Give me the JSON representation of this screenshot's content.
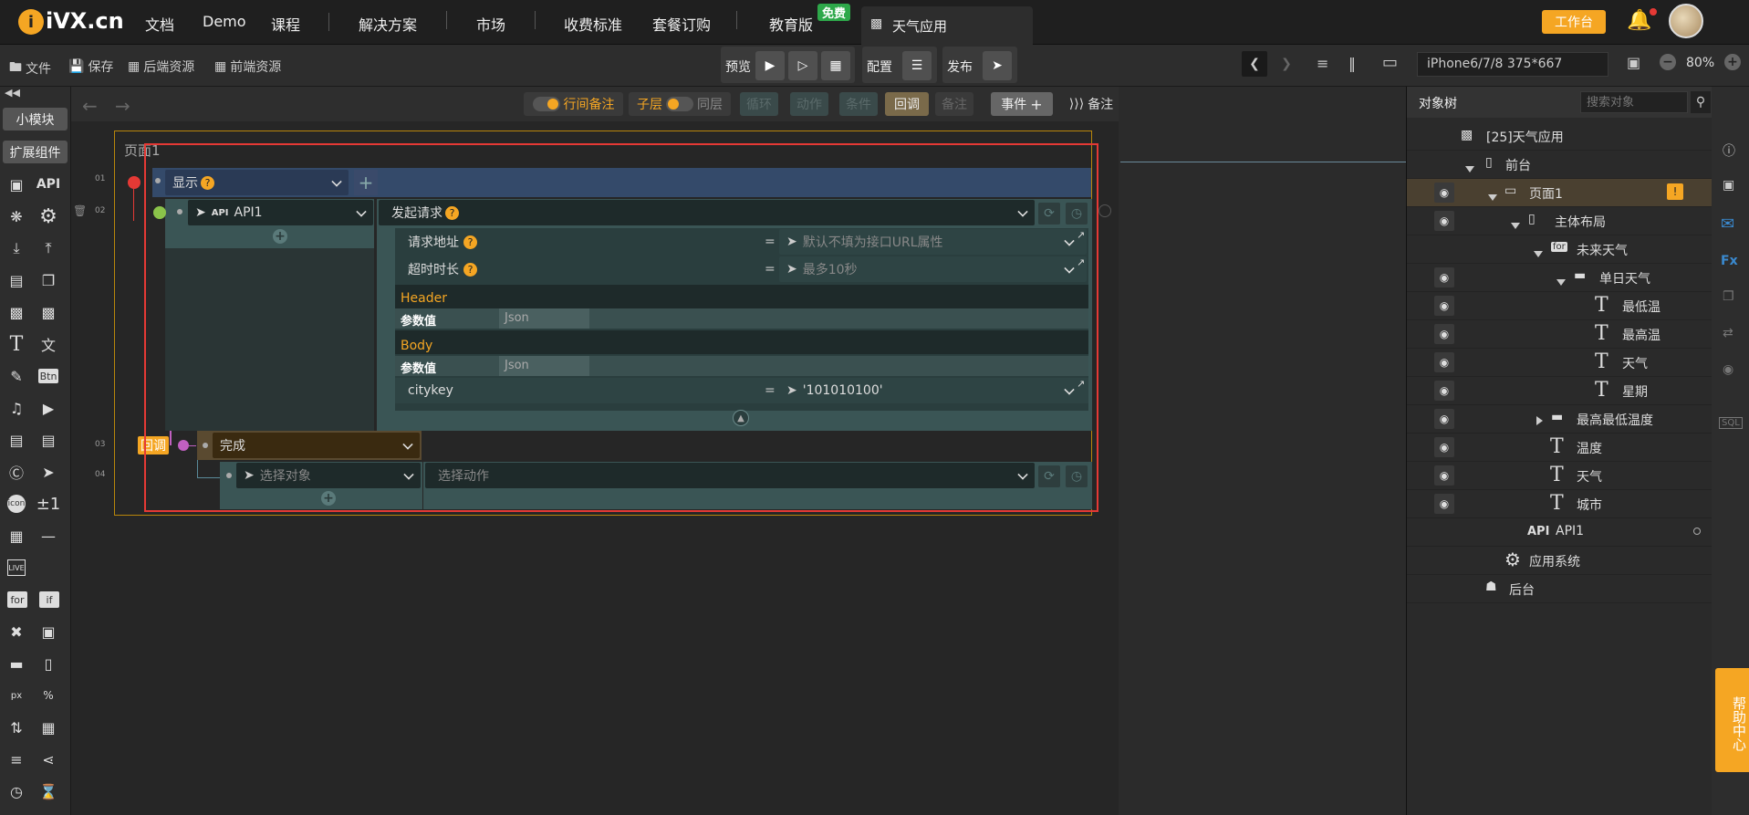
{
  "brand": {
    "logo": "iVX.cn"
  },
  "nav": {
    "items": [
      "文档",
      "Demo",
      "课程",
      "解决方案",
      "市场",
      "收费标准",
      "套餐订购",
      "教育版"
    ],
    "free_badge": "免费",
    "app_tab": "天气应用",
    "workbench": "工作台"
  },
  "toolbar": {
    "file": "文件",
    "save": "保存",
    "backend": "后端资源",
    "frontend": "前端资源",
    "preview": "预览",
    "config": "配置",
    "publish": "发布",
    "device": "iPhone6/7/8 375*667",
    "zoom": "80%"
  },
  "leftpanel": {
    "tab_module": "小模块",
    "tab_ext": "扩展组件",
    "api_label": "API",
    "btn_label": "Btn",
    "icon_label": "icon",
    "pm_label": "±1",
    "live_label": "LIVE",
    "for_label": "for",
    "if_label": "if",
    "px_label": "px",
    "pct_label": "%"
  },
  "eventbar": {
    "row_note": "行间备注",
    "child": "子层",
    "same": "同层",
    "loop": "循环",
    "action": "动作",
    "condition": "条件",
    "callback": "回调",
    "note": "备注",
    "event": "事件",
    "notes": "备注"
  },
  "editor": {
    "page_label": "页面1",
    "lines": [
      "01",
      "02",
      "03",
      "04"
    ],
    "show": "显示",
    "api_tag": "API",
    "api_name": "API1",
    "request": "发起请求",
    "url_label": "请求地址",
    "url_placeholder": "默认不填为接口URL属性",
    "timeout_label": "超时时长",
    "timeout_placeholder": "最多10秒",
    "header": "Header",
    "body": "Body",
    "param_value": "参数值",
    "json": "Json",
    "citykey": "citykey",
    "citykey_value": "'101010100'",
    "callback_tag": "回调",
    "done": "完成",
    "select_object": "选择对象",
    "select_action": "选择动作",
    "eq": "="
  },
  "tree": {
    "title": "对象树",
    "search_placeholder": "搜索对象",
    "items": [
      {
        "label": "[25]天气应用"
      },
      {
        "label": "前台"
      },
      {
        "label": "页面1"
      },
      {
        "label": "主体布局"
      },
      {
        "label": "未来天气"
      },
      {
        "label": "单日天气"
      },
      {
        "label": "最低温"
      },
      {
        "label": "最高温"
      },
      {
        "label": "天气"
      },
      {
        "label": "星期"
      },
      {
        "label": "最高最低温度"
      },
      {
        "label": "温度"
      },
      {
        "label": "天气"
      },
      {
        "label": "城市"
      },
      {
        "label": "API1",
        "tag": "API"
      },
      {
        "label": "应用系统"
      },
      {
        "label": "后台"
      }
    ],
    "for_tag": "for"
  },
  "help": {
    "label": "帮助中心"
  },
  "colors": {
    "accent": "#f5a623",
    "red_box": "#e53935",
    "bg": "#262626"
  }
}
